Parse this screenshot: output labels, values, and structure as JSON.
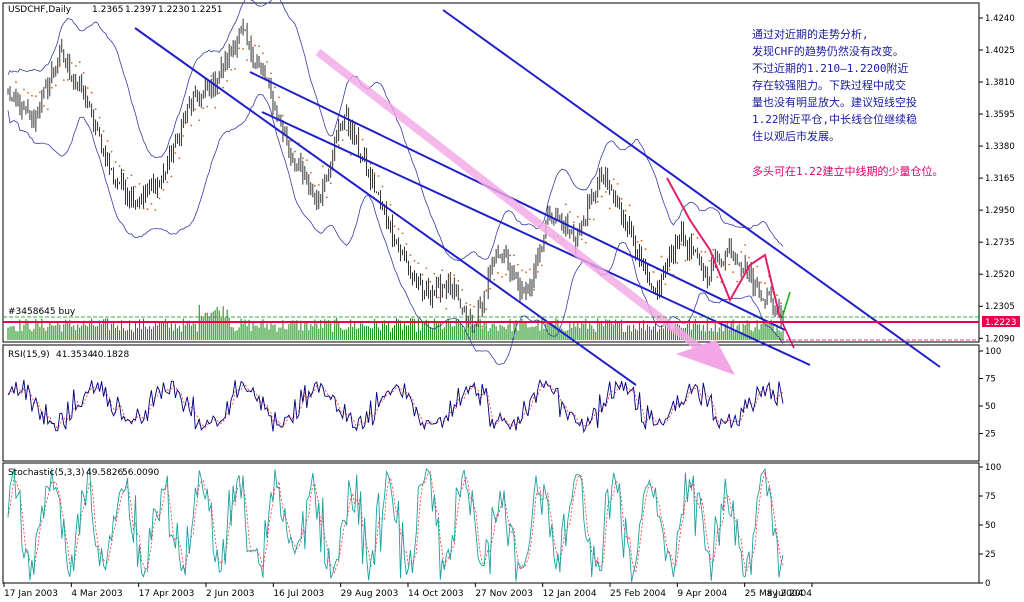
{
  "chart_data": [
    {
      "type": "candlestick",
      "panel": "price",
      "symbol_label": "USDCHF,Daily",
      "ohlc_header": [
        "1.2365",
        "1.2397",
        "1.2230",
        "1.2251"
      ],
      "volume_label": "#3458645 buy",
      "current_price_tag": "1.2223",
      "y_ticks": [
        "1.4240",
        "1.4025",
        "1.3810",
        "1.3595",
        "1.3380",
        "1.3165",
        "1.2950",
        "1.2735",
        "1.2520",
        "1.2305",
        "1.2090"
      ],
      "ylim": [
        1.2065,
        1.428
      ],
      "x_ticks": [
        "17 Jan 2003",
        "4 Mar 2003",
        "17 Apr 2003",
        "2 Jun 2003",
        "16 Jul 2003",
        "29 Aug 2003",
        "14 Oct 2003",
        "27 Nov 2003",
        "12 Jan 2004",
        "25 Feb 2004",
        "9 Apr 2004",
        "25 May 2004",
        "8 Jul 2004"
      ],
      "close_path": [
        1.372,
        1.355,
        1.4,
        1.37,
        1.32,
        1.3,
        1.318,
        1.365,
        1.38,
        1.415,
        1.382,
        1.33,
        1.3,
        1.36,
        1.318,
        1.275,
        1.238,
        1.245,
        1.215,
        1.27,
        1.235,
        1.295,
        1.275,
        1.318,
        1.285,
        1.235,
        1.28,
        1.252,
        1.27,
        1.243,
        1.225
      ],
      "annotation_lines": [
        "通过对近期的走势分析,",
        "发现CHF的趋势仍然没有改变。",
        "不过近期的1.210—1.2200附近",
        "存在较强阻力。下跌过程中成交",
        "量也没有明显放大。建议短线空投",
        "1.22附近平仓,中长线仓位继续稳",
        "住以观后市发展。"
      ],
      "annotation_highlight": "多头可在1.22建立中线期的少量仓位。"
    },
    {
      "type": "line",
      "panel": "rsi",
      "label": "RSI(15,9)",
      "values_header": [
        "41.3534",
        "40.1828"
      ],
      "y_ticks": [
        "100",
        "75",
        "50",
        "25"
      ],
      "ylim": [
        0,
        100
      ]
    },
    {
      "type": "line",
      "panel": "stochastic",
      "label": "Stochastic(5,3,3)",
      "values_header": [
        "49.5826",
        "56.0090"
      ],
      "y_ticks": [
        "100",
        "75",
        "50",
        "25",
        "0"
      ],
      "ylim": [
        0,
        100
      ]
    }
  ],
  "colors": {
    "candles": "#000000",
    "bollinger": "#3a3aa8",
    "parabolic_sar": "#e06010",
    "channel": "#2020c8",
    "projection_arrow": "#f3a6e6",
    "support_line": "#e8004c",
    "volume": "#0a8a0a",
    "rsi_main": "#00007a",
    "rsi_signal": "#ff3030",
    "stoch_main": "#1ea0a0",
    "stoch_signal": "#ff3030"
  }
}
